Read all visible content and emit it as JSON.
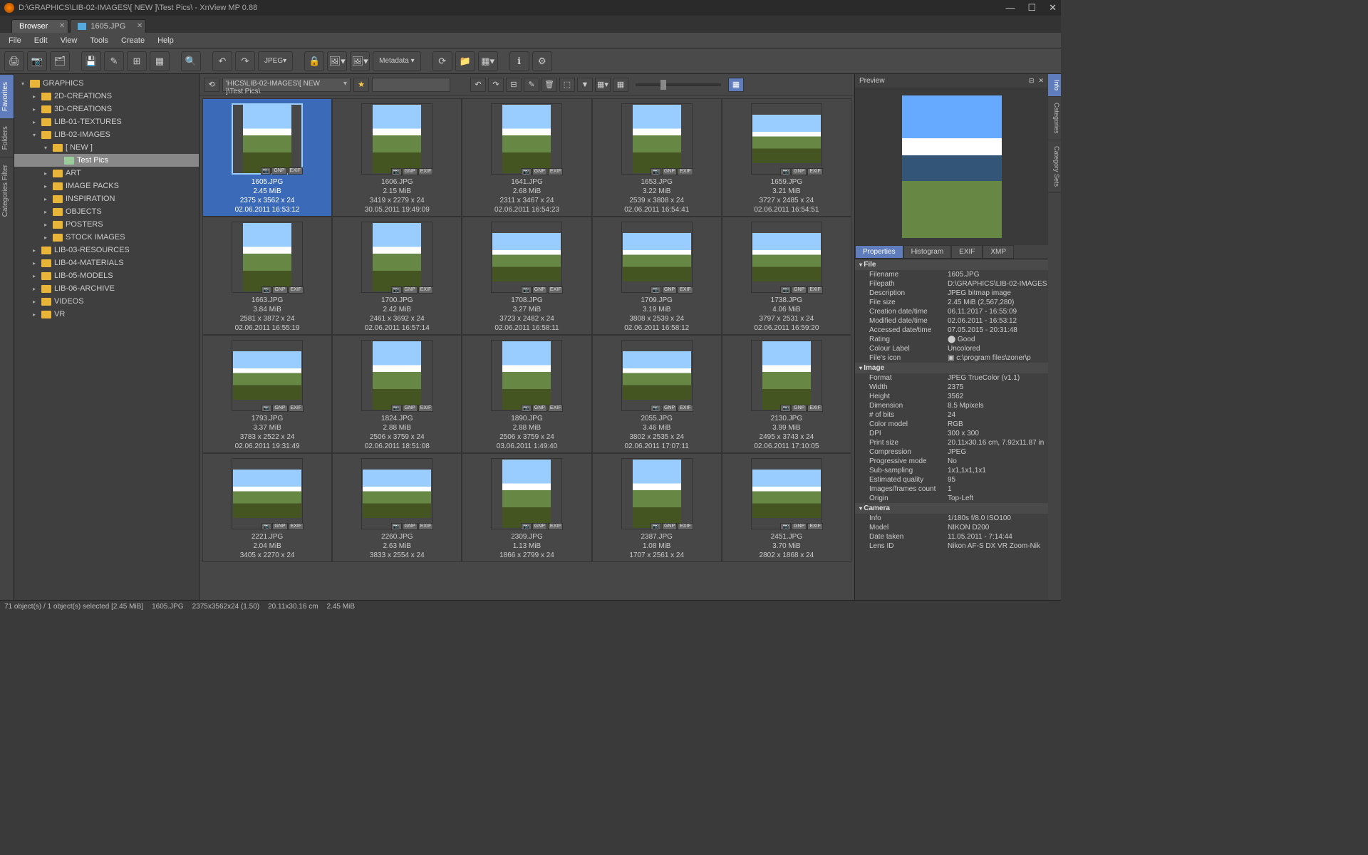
{
  "window": {
    "title": "D:\\GRAPHICS\\LIB-02-IMAGES\\[ NEW ]\\Test Pics\\ - XnView MP 0.88"
  },
  "tabs": [
    {
      "label": "Browser",
      "active": true,
      "icon": false
    },
    {
      "label": "1605.JPG",
      "active": false,
      "icon": true
    }
  ],
  "menu": [
    "File",
    "Edit",
    "View",
    "Tools",
    "Create",
    "Help"
  ],
  "toolbar_groups": [
    [
      "🖨",
      "📷",
      "🗂"
    ],
    [
      "💾",
      "✎",
      "⊞",
      "▦"
    ],
    [
      "🔍"
    ],
    [
      "↶",
      "↷",
      "JPEG▾"
    ],
    [
      "🔒",
      "🖼▾",
      "🖼▾",
      "Metadata ▾"
    ],
    [
      "⟳",
      "📁",
      "▦▾"
    ],
    [
      "ℹ",
      "⚙"
    ]
  ],
  "addrbar": {
    "back_icon": "⟲",
    "path": "'HICS\\LIB-02-IMAGES\\[ NEW ]\\Test Pics\\",
    "star": "★",
    "search_ph": "",
    "btns": [
      "↶",
      "↷",
      "⊟",
      "✎",
      "🗑",
      "⬚",
      "▼",
      "▦▾",
      "▦"
    ]
  },
  "sidetabs_left": [
    "Favorites",
    "Folders",
    "Categories Filter"
  ],
  "sidetabs_right": [
    "Info",
    "Categories",
    "Category Sets"
  ],
  "tree": [
    {
      "d": 0,
      "ar": "▾",
      "label": "GRAPHICS"
    },
    {
      "d": 1,
      "ar": "▸",
      "label": "2D-CREATIONS"
    },
    {
      "d": 1,
      "ar": "▸",
      "label": "3D-CREATIONS"
    },
    {
      "d": 1,
      "ar": "▸",
      "label": "LIB-01-TEXTURES"
    },
    {
      "d": 1,
      "ar": "▾",
      "label": "LIB-02-IMAGES"
    },
    {
      "d": 2,
      "ar": "▾",
      "label": "[ NEW ]"
    },
    {
      "d": 3,
      "ar": "",
      "label": "Test Pics",
      "sel": true,
      "g": true
    },
    {
      "d": 2,
      "ar": "▸",
      "label": "ART"
    },
    {
      "d": 2,
      "ar": "▸",
      "label": "IMAGE PACKS"
    },
    {
      "d": 2,
      "ar": "▸",
      "label": "INSPIRATION"
    },
    {
      "d": 2,
      "ar": "▸",
      "label": "OBJECTS"
    },
    {
      "d": 2,
      "ar": "▸",
      "label": "POSTERS"
    },
    {
      "d": 2,
      "ar": "▸",
      "label": "STOCK IMAGES"
    },
    {
      "d": 1,
      "ar": "▸",
      "label": "LIB-03-RESOURCES"
    },
    {
      "d": 1,
      "ar": "▸",
      "label": "LIB-04-MATERIALS"
    },
    {
      "d": 1,
      "ar": "▸",
      "label": "LIB-05-MODELS"
    },
    {
      "d": 1,
      "ar": "▸",
      "label": "LIB-06-ARCHIVE"
    },
    {
      "d": 1,
      "ar": "▸",
      "label": "VIDEOS"
    },
    {
      "d": 1,
      "ar": "▸",
      "label": "VR"
    }
  ],
  "thumb_badges": [
    "📷",
    "GNP",
    "EXIF"
  ],
  "thumbs": [
    {
      "name": "1605.JPG",
      "size": "2.45 MiB",
      "dim": "2375 x 3562 x 24",
      "date": "02.06.2011 16:53:12",
      "o": "port",
      "sel": true
    },
    {
      "name": "1606.JPG",
      "size": "2.15 MiB",
      "dim": "3419 x 2279 x 24",
      "date": "30.05.2011 19:49:09",
      "o": "port"
    },
    {
      "name": "1641.JPG",
      "size": "2.68 MiB",
      "dim": "2311 x 3467 x 24",
      "date": "02.06.2011 16:54:23",
      "o": "port"
    },
    {
      "name": "1653.JPG",
      "size": "3.22 MiB",
      "dim": "2539 x 3808 x 24",
      "date": "02.06.2011 16:54:41",
      "o": "port"
    },
    {
      "name": "1659.JPG",
      "size": "3.21 MiB",
      "dim": "3727 x 2485 x 24",
      "date": "02.06.2011 16:54:51",
      "o": "land"
    },
    {
      "name": "1663.JPG",
      "size": "3.84 MiB",
      "dim": "2581 x 3872 x 24",
      "date": "02.06.2011 16:55:19",
      "o": "port"
    },
    {
      "name": "1700.JPG",
      "size": "2.42 MiB",
      "dim": "2461 x 3692 x 24",
      "date": "02.06.2011 16:57:14",
      "o": "port"
    },
    {
      "name": "1708.JPG",
      "size": "3.27 MiB",
      "dim": "3723 x 2482 x 24",
      "date": "02.06.2011 16:58:11",
      "o": "land"
    },
    {
      "name": "1709.JPG",
      "size": "3.19 MiB",
      "dim": "3808 x 2539 x 24",
      "date": "02.06.2011 16:58:12",
      "o": "land"
    },
    {
      "name": "1738.JPG",
      "size": "4.06 MiB",
      "dim": "3797 x 2531 x 24",
      "date": "02.06.2011 16:59:20",
      "o": "land"
    },
    {
      "name": "1793.JPG",
      "size": "3.37 MiB",
      "dim": "3783 x 2522 x 24",
      "date": "02.06.2011 19:31:49",
      "o": "land"
    },
    {
      "name": "1824.JPG",
      "size": "2.88 MiB",
      "dim": "2506 x 3759 x 24",
      "date": "02.06.2011 18:51:08",
      "o": "port"
    },
    {
      "name": "1890.JPG",
      "size": "2.88 MiB",
      "dim": "2506 x 3759 x 24",
      "date": "03.06.2011 1:49:40",
      "o": "port"
    },
    {
      "name": "2055.JPG",
      "size": "3.46 MiB",
      "dim": "3802 x 2535 x 24",
      "date": "02.06.2011 17:07:11",
      "o": "land"
    },
    {
      "name": "2130.JPG",
      "size": "3.99 MiB",
      "dim": "2495 x 3743 x 24",
      "date": "02.06.2011 17:10:05",
      "o": "port"
    },
    {
      "name": "2221.JPG",
      "size": "2.04 MiB",
      "dim": "3405 x 2270 x 24",
      "date": "",
      "o": "land"
    },
    {
      "name": "2260.JPG",
      "size": "2.63 MiB",
      "dim": "3833 x 2554 x 24",
      "date": "",
      "o": "land"
    },
    {
      "name": "2309.JPG",
      "size": "1.13 MiB",
      "dim": "1866 x 2799 x 24",
      "date": "",
      "o": "port"
    },
    {
      "name": "2387.JPG",
      "size": "1.08 MiB",
      "dim": "1707 x 2561 x 24",
      "date": "",
      "o": "port"
    },
    {
      "name": "2451.JPG",
      "size": "3.70 MiB",
      "dim": "2802 x 1868 x 24",
      "date": "",
      "o": "land"
    }
  ],
  "preview_header": "Preview",
  "prop_tabs": [
    "Properties",
    "Histogram",
    "EXIF",
    "XMP"
  ],
  "props": {
    "File": [
      [
        "Filename",
        "1605.JPG"
      ],
      [
        "Filepath",
        "D:\\GRAPHICS\\LIB-02-IMAGES"
      ],
      [
        "Description",
        "JPEG bitmap image"
      ],
      [
        "File size",
        "2.45 MiB (2,567,280)"
      ],
      [
        "Creation date/time",
        "06.11.2017 - 16:55:09"
      ],
      [
        "Modified date/time",
        "02.06.2011 - 16:53:12"
      ],
      [
        "Accessed date/time",
        "07.05.2015 - 20:31:48"
      ],
      [
        "Rating",
        "⬤ Good"
      ],
      [
        "Colour Label",
        "Uncolored"
      ],
      [
        "File's icon",
        "▣ c:\\program files\\zoner\\p"
      ]
    ],
    "Image": [
      [
        "Format",
        "JPEG TrueColor (v1.1)"
      ],
      [
        "Width",
        "2375"
      ],
      [
        "Height",
        "3562"
      ],
      [
        "Dimension",
        "8.5 Mpixels"
      ],
      [
        "# of bits",
        "24"
      ],
      [
        "Color model",
        "RGB"
      ],
      [
        "DPI",
        "300 x 300"
      ],
      [
        "Print size",
        "20.11x30.16 cm, 7.92x11.87 in"
      ],
      [
        "Compression",
        "JPEG"
      ],
      [
        "Progressive mode",
        "No"
      ],
      [
        "Sub-sampling",
        "1x1,1x1,1x1"
      ],
      [
        "Estimated quality",
        "95"
      ],
      [
        "Images/frames count",
        "1"
      ],
      [
        "Origin",
        "Top-Left"
      ]
    ],
    "Camera": [
      [
        "Info",
        "1/180s f/8.0 ISO100"
      ],
      [
        "Model",
        "NIKON D200"
      ],
      [
        "Date taken",
        "11.05.2011 - 7:14:44"
      ],
      [
        "Lens ID",
        "Nikon AF-S DX VR Zoom-Nik"
      ]
    ]
  },
  "statusbar": [
    "71 object(s) / 1 object(s) selected [2.45 MiB]",
    "1605.JPG",
    "2375x3562x24 (1.50)",
    "20.11x30.16 cm",
    "2.45 MiB"
  ]
}
